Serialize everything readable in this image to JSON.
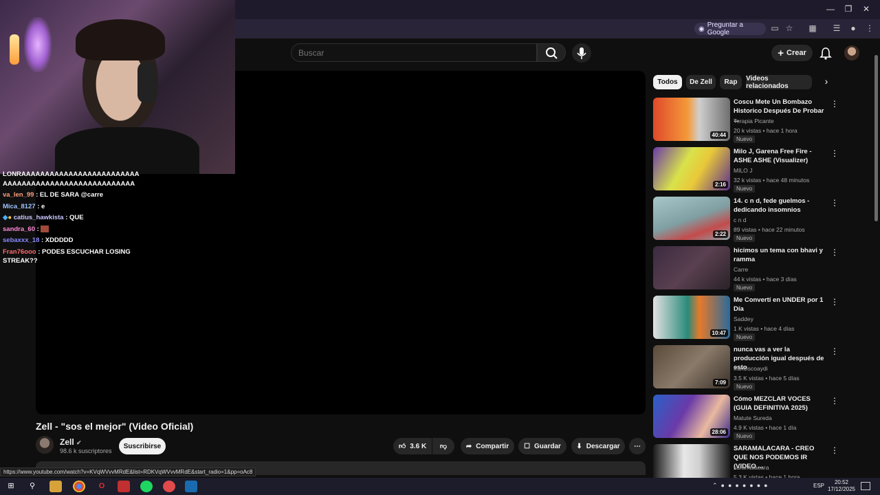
{
  "browser": {
    "ask_google_label": "Preguntar a Google",
    "status_url": "https://www.youtube.com/watch?v=KVqWVvvMRdE&list=RDKVqWVvvMRdE&start_radio=1&pp=oAc8"
  },
  "header": {
    "search_placeholder": "Buscar",
    "create_label": "Crear"
  },
  "chat": [
    {
      "user": "",
      "text": "LONRAAAAAAAAAAAAAAAAAAAAAAAAA AAAAAAAAAAAAAAAAAAAAAAAAAAAA",
      "color": "#ffffff"
    },
    {
      "user": "va_len_99",
      "text": ": EL DE SARA @carre",
      "color": "#ff9f80"
    },
    {
      "user": "Mica_8127",
      "text": ": e",
      "color": "#a0c4ff"
    },
    {
      "user": "catius_hawkista",
      "text": ": QUE",
      "color": "#c8c8ff"
    },
    {
      "user": "sandra_60",
      "text": ":",
      "color": "#ff8ad8"
    },
    {
      "user": "sebaxxx_18",
      "text": ": XDDDDD",
      "color": "#8a8aff"
    },
    {
      "user": "Fran76ooo",
      "text": ": PODES ESCUCHAR LOSING STREAK??",
      "color": "#ff6b6b"
    }
  ],
  "video": {
    "title": "Zell - \"sos el mejor\" (Video Oficial)",
    "channel": "Zell",
    "subscribers": "98.6 k suscriptores",
    "subscribe_label": "Suscribirse",
    "likes": "3.6 K",
    "share_label": "Compartir",
    "save_label": "Guardar",
    "download_label": "Descargar"
  },
  "chips": [
    "Todos",
    "De Zell",
    "Rap",
    "Videos relacionados"
  ],
  "recommendations": [
    {
      "title": "Coscu Mete Un Bombazo Historico Después De Probar ...",
      "channel": "Terapia Picante",
      "meta": "20 k vistas • hace 1 hora",
      "duration": "40:44",
      "badge": "Nuevo",
      "thumb": "linear-gradient(90deg,#e0492a,#f39a3a 45%,#cfcfcf 60%,#6f6f6f)"
    },
    {
      "title": "Milo J, Garena Free Fire - ASHE ASHE (Visualizer)",
      "channel": "MILO J",
      "meta": "32 k vistas • hace 48 minutos",
      "duration": "2:16",
      "badge": "Nuevo",
      "thumb": "linear-gradient(120deg,#6b3aa8,#d8e24a 40%,#e9c83a 60%,#5a2f8e)"
    },
    {
      "title": "14. c n d, fede guelmos - dedicando insomnios",
      "channel": "c n d",
      "meta": "89 vistas • hace 22 minutos",
      "duration": "2:22",
      "badge": "Nuevo",
      "thumb": "linear-gradient(160deg,#a9c7c9,#7f9fa3 50%,#c44b4b 75%,#8aa3a8)"
    },
    {
      "title": "hicimos un tema con bhavi y ramma",
      "channel": "Carre",
      "meta": "44 k vistas • hace 3 días",
      "duration": "",
      "badge": "Nuevo",
      "thumb": "linear-gradient(135deg,#3b2a3f,#5a4050 50%,#2a2228)"
    },
    {
      "title": "Me Convertí en UNDER por 1 Día",
      "channel": "Saddey",
      "meta": "1 K vistas • hace 4 días",
      "duration": "10:47",
      "badge": "Nuevo",
      "thumb": "linear-gradient(90deg,#e2e2e2,#2a8a7a 45%,#e67a2a 60%,#2a6a9a)"
    },
    {
      "title": "nunca vas a ver la producción igual después de esto",
      "channel": "franciscoaydi",
      "meta": "3.5 K vistas • hace 5 días",
      "duration": "7:09",
      "badge": "Nuevo",
      "thumb": "linear-gradient(135deg,#5a4a3a,#8a7a6a 50%,#3a3028)"
    },
    {
      "title": "Cómo MEZCLAR VOCES (GUIA DEFINITIVA 2025)",
      "channel": "Matute Sureda",
      "meta": "4.9 K vistas • hace 1 día",
      "duration": "28:06",
      "badge": "Nuevo",
      "thumb": "linear-gradient(120deg,#2a60c8,#6a3aa8 40%,#e9b9a0 70%,#3a2a8a)"
    },
    {
      "title": "SARAMALACARA - CREO QUE NOS PODEMOS IR (VIDEO ...",
      "channel": "saramalacara",
      "meta": "5.3 K vistas • hace 1 hora",
      "duration": "",
      "badge": "",
      "thumb": "linear-gradient(90deg,#1a1a1a,#e8e8e8 40%,#d0d0d0 60%,#1a1a1a)"
    }
  ],
  "taskbar": {
    "lang": "ESP",
    "time": "20:52",
    "date": "17/12/2025"
  }
}
